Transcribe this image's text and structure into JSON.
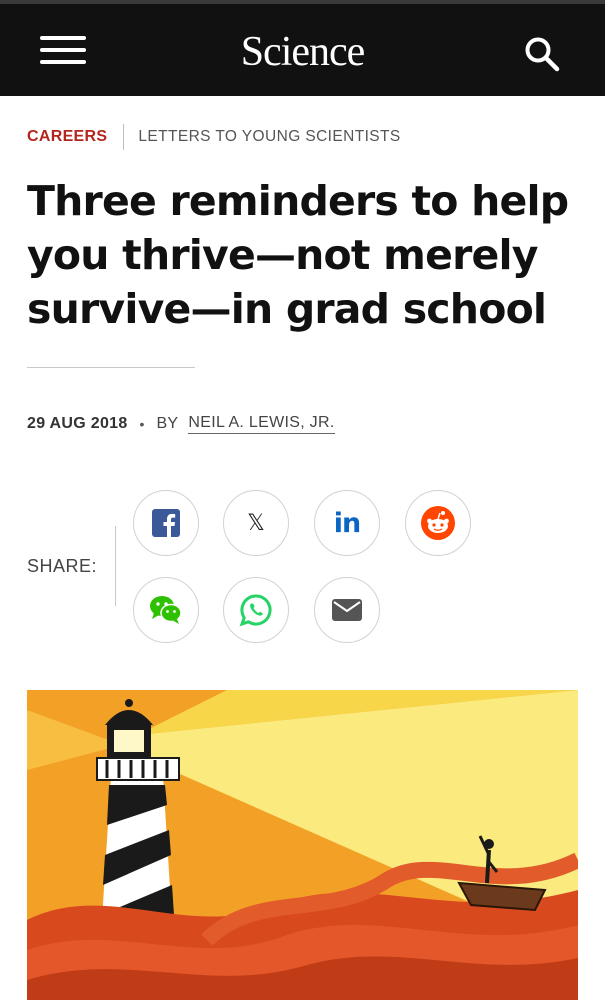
{
  "header": {
    "logo": "Science",
    "menu_icon": "hamburger-menu-icon",
    "search_icon": "search-icon",
    "background": "#111111"
  },
  "breadcrumb": {
    "section": "CAREERS",
    "series": "LETTERS TO YOUNG SCIENTISTS",
    "section_color": "#b3261e"
  },
  "article": {
    "title_lines": [
      "Three reminders to help",
      "you thrive—not merely",
      "survive—in grad school"
    ],
    "date": "29 AUG 2018",
    "separator": "•",
    "by": "BY",
    "author": "NEIL A. LEWIS, JR."
  },
  "share": {
    "label": "SHARE:",
    "buttons": [
      {
        "name": "facebook",
        "icon": "facebook-icon",
        "color": "#3b5998"
      },
      {
        "name": "x",
        "icon": "x-icon",
        "glyph": "𝕏",
        "color": "#222222"
      },
      {
        "name": "linkedin",
        "icon": "linkedin-icon",
        "glyph": "in",
        "color": "#0a66c2"
      },
      {
        "name": "reddit",
        "icon": "reddit-icon",
        "color": "#ff4500"
      },
      {
        "name": "wechat",
        "icon": "wechat-icon",
        "color": "#2dc100"
      },
      {
        "name": "whatsapp",
        "icon": "whatsapp-icon",
        "color": "#25d366"
      },
      {
        "name": "email",
        "icon": "email-icon",
        "color": "#555555"
      }
    ]
  },
  "hero_image": {
    "icon": "lighthouse-illustration",
    "colors": {
      "sky": "#f6d24a",
      "beam": "#fbea7e",
      "sea": "#d84a1e",
      "tower_stripe": "#1a1a1a"
    }
  }
}
